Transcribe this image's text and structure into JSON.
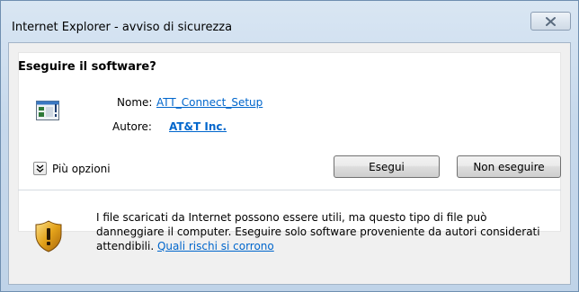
{
  "window": {
    "title": "Internet Explorer - avviso di sicurezza"
  },
  "dialog": {
    "heading": "Eseguire il software?",
    "name_label": "Nome:",
    "name_value": "ATT_Connect_Setup",
    "author_label": "Autore:",
    "author_value": "AT&T Inc.",
    "more_options_label": "Più opzioni",
    "run_button": "Esegui",
    "dont_run_button": "Non eseguire",
    "warning_text": "I file scaricati da Internet possono essere utili, ma questo tipo di file può danneggiare il computer. Eseguire solo software proveniente da autori considerati attendibili.",
    "risk_link": "Quali rischi si corrono"
  },
  "icons": {
    "close": "close-icon",
    "app": "application-icon",
    "chevron": "double-chevron-down-icon",
    "shield": "security-shield-icon"
  },
  "colors": {
    "link": "#0066cc",
    "shield_gold": "#e3a21a"
  }
}
